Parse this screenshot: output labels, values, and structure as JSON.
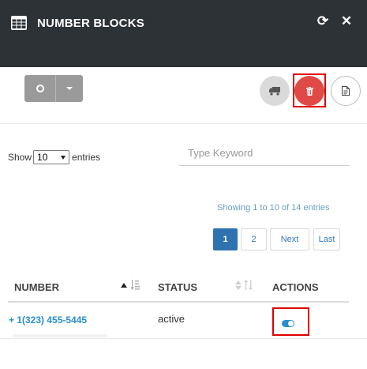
{
  "header": {
    "title": "NUMBER BLOCKS",
    "icons": {
      "title": "table-grid-icon",
      "refresh": "refresh-icon",
      "close": "close-icon"
    },
    "refresh_glyph": "⟳",
    "close_glyph": "✕"
  },
  "toolbar": {
    "split_button_icon": "circle-icon",
    "buttons": [
      "truck-icon",
      "trash-icon",
      "document-icon"
    ]
  },
  "table_controls": {
    "show_label": "Show",
    "page_size": "10",
    "entries_label": "entries",
    "search_placeholder": "Type Keyword",
    "info": "Showing 1 to 10 of 14 entries"
  },
  "pagination": {
    "pages": [
      "1",
      "2"
    ],
    "current": "1",
    "next": "Next",
    "last": "Last"
  },
  "table": {
    "columns": [
      "NUMBER",
      "STATUS",
      "ACTIONS"
    ],
    "rows": [
      {
        "number": "+ 1(323) 455-5445",
        "status": "active",
        "action": "toggle-icon"
      }
    ]
  },
  "colors": {
    "header_bg": "#2d3237",
    "accent_blue": "#2e73b0",
    "delete_red": "#e04a46",
    "highlight_red": "#e00000"
  }
}
